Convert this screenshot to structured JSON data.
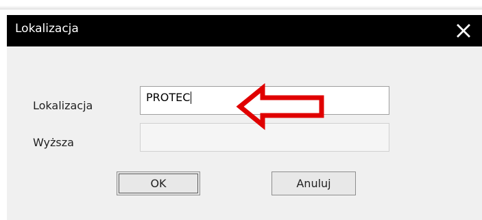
{
  "window": {
    "title": "Lokalizacja",
    "close_icon": "close-icon"
  },
  "form": {
    "lokalizacja": {
      "label": "Lokalizacja",
      "value": "PROTEC"
    },
    "wyzsza": {
      "label": "Wyższa",
      "value": ""
    }
  },
  "buttons": {
    "ok_label": "OK",
    "cancel_label": "Anuluj"
  },
  "annotation": {
    "icon": "red-arrow-icon",
    "color": "#e00000"
  },
  "colors": {
    "titlebar": "#000000",
    "dialog_bg": "#f0f0f0",
    "input_bg": "#ffffff",
    "disabled_input_bg": "#f5f5f5"
  }
}
